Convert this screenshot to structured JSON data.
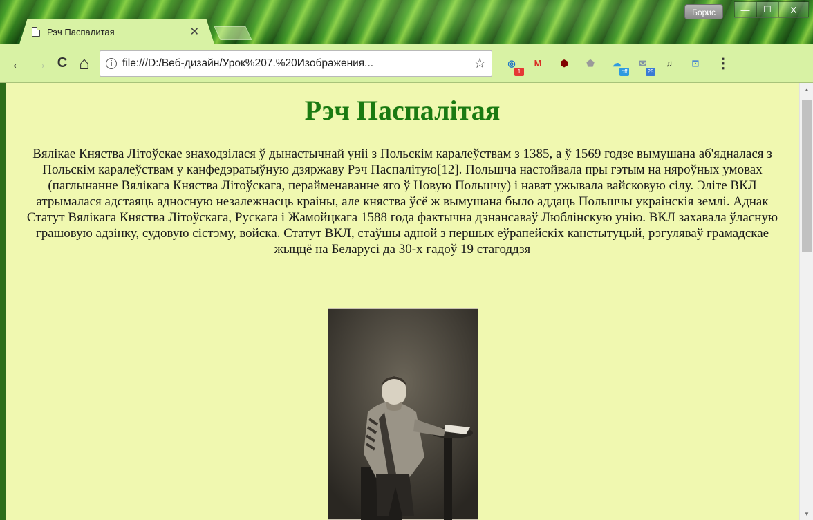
{
  "window": {
    "user_name": "Борис",
    "minimize_glyph": "—",
    "maximize_glyph": "☐",
    "close_glyph": "X"
  },
  "tab": {
    "title": "Рэч Паспалитая",
    "close_glyph": "✕"
  },
  "toolbar": {
    "back_glyph": "←",
    "forward_glyph": "→",
    "reload_glyph": "C",
    "home_glyph": "⌂",
    "info_glyph": "i",
    "url": "file:///D:/Веб-дизайн/Урок%207.%20Изображения...",
    "star_glyph": "☆",
    "menu_glyph": "⋮"
  },
  "extensions": [
    {
      "icon": "o-extension-icon",
      "glyph": "◎",
      "color": "#1a73c8",
      "badge": "1",
      "badge_color": "#e53935"
    },
    {
      "icon": "gmail-icon",
      "glyph": "M",
      "color": "#d93025",
      "badge": "",
      "badge_color": ""
    },
    {
      "icon": "ublock-icon",
      "glyph": "⬢",
      "color": "#800000",
      "badge": "",
      "badge_color": ""
    },
    {
      "icon": "shield-icon",
      "glyph": "⬟",
      "color": "#9a9a9a",
      "badge": "",
      "badge_color": ""
    },
    {
      "icon": "cloud-extension-icon",
      "glyph": "☁",
      "color": "#2e9ae0",
      "badge": "off",
      "badge_color": "#2e9ae0"
    },
    {
      "icon": "mail-extension-icon",
      "glyph": "✉",
      "color": "#7d8fa3",
      "badge": "25",
      "badge_color": "#3a7bd5"
    },
    {
      "icon": "music-extension-icon",
      "glyph": "♫",
      "color": "#333333",
      "badge": "",
      "badge_color": ""
    },
    {
      "icon": "translate-extension-icon",
      "glyph": "⊡",
      "color": "#3a7bd5",
      "badge": "",
      "badge_color": ""
    }
  ],
  "page": {
    "title": "Рэч Паспалітая",
    "paragraph": "Вялікае Княства Літоўскае знаходзілася ў дынастычнай уніі з Польскім каралеўствам з 1385, а ў 1569 годзе вымушана аб'ядналася з Польскім каралеўствам у канфедэратыўную дзяржаву Рэч Паспалітую[12]. Польшча настойвала пры гэтым на няроўных умовах (паглынанне Вялікага Княства Літоўскага, перайменаванне яго ў Новую Польшчу) і нават ужывала вайсковую сілу. Эліте ВКЛ атрымалася адстаяць адносную незалежнасць краіны, але княства ўсё ж вымушана было аддаць Польшчы украінскія землі. Аднак Статут Вялікага Княства Літоўскага, Рускага і Жамойцкага 1588 года фактычна дэнансаваў Люблінскую унію. ВКЛ захавала ўласную грашовую адзінку, судовую сістэму, войска. Статут ВКЛ, стаўшы адной з першых еўрапейскіх канстытуцый, рэгуляваў грамадскае жыццё на Беларусі да 30-х гадоў 19 стагоддзя",
    "background_color": "#f0f8b0",
    "title_color": "#1a7a12"
  },
  "scrollbar": {
    "up_glyph": "▲",
    "down_glyph": "▼"
  }
}
